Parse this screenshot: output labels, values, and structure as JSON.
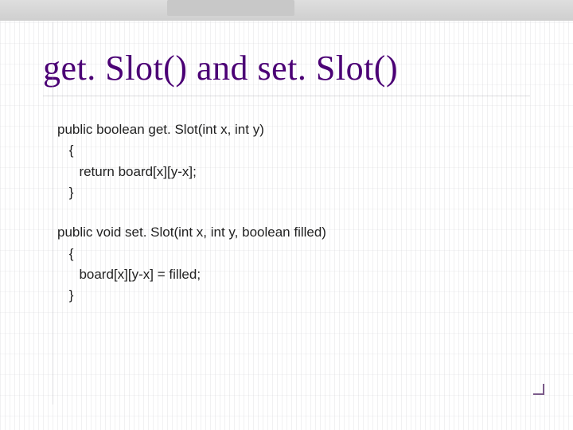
{
  "title": "get. Slot() and set. Slot()",
  "code": {
    "block1": {
      "l1": "public boolean get. Slot(int x, int y)",
      "l2": " {",
      "l3": "  return board[x][y-x];",
      "l4": " }"
    },
    "block2": {
      "l1": "public void set. Slot(int x, int y, boolean filled)",
      "l2": " {",
      "l3": "  board[x][y-x] = filled;",
      "l4": " }"
    }
  }
}
